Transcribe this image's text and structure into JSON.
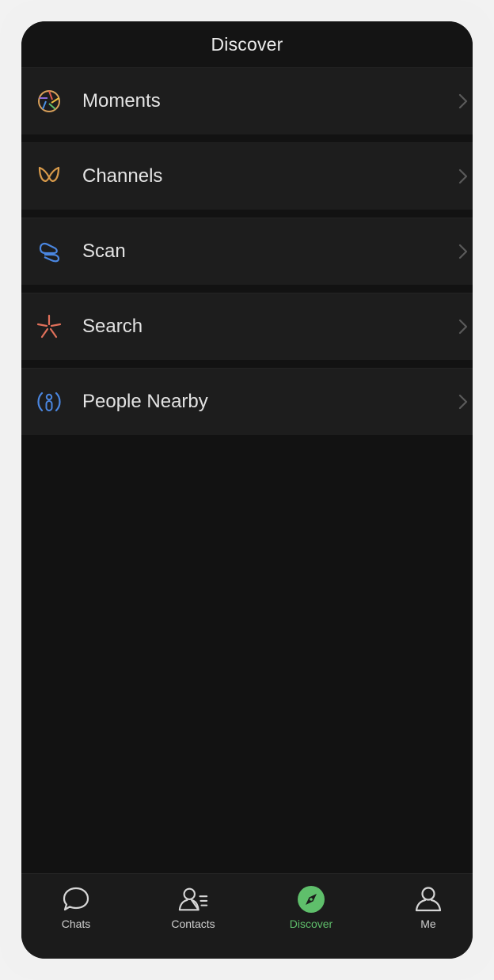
{
  "header": {
    "title": "Discover"
  },
  "menu": {
    "items": [
      {
        "label": "Moments",
        "icon": "moments-icon"
      },
      {
        "label": "Channels",
        "icon": "channels-icon"
      },
      {
        "label": "Scan",
        "icon": "scan-icon"
      },
      {
        "label": "Search",
        "icon": "search-icon"
      },
      {
        "label": "People Nearby",
        "icon": "people-nearby-icon"
      }
    ]
  },
  "tabbar": {
    "tabs": [
      {
        "label": "Chats",
        "icon": "chat-bubble-icon"
      },
      {
        "label": "Contacts",
        "icon": "contacts-icon"
      },
      {
        "label": "Discover",
        "icon": "compass-icon",
        "active": true
      },
      {
        "label": "Me",
        "icon": "person-icon"
      }
    ]
  },
  "colors": {
    "background": "#121212",
    "row": "#1d1d1d",
    "text": "#e3e3e3",
    "accent": "#5fbf6b"
  }
}
